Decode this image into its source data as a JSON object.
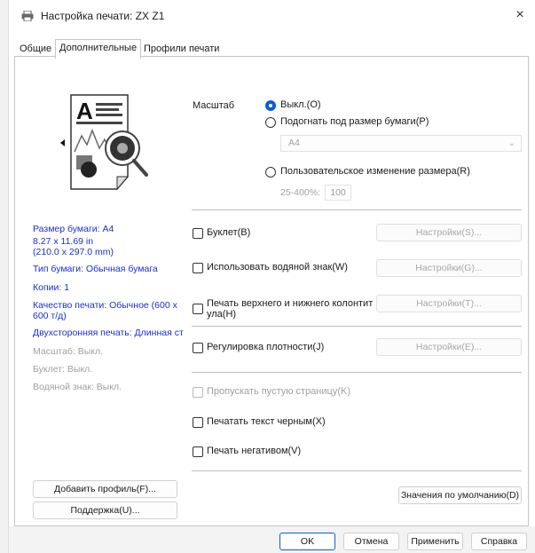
{
  "window": {
    "title": "Настройка печати: ZX Z1",
    "close_symbol": "×"
  },
  "tabs": [
    "Общие",
    "Дополнительные",
    "Профили печати"
  ],
  "summary": {
    "paper_size": "Размер бумаги: A4",
    "paper_dims_1": "8.27 x 11.69 in",
    "paper_dims_2": "(210.0 x 297.0 mm)",
    "paper_type": "Тип бумаги: Обычная бумага",
    "copies": "Копии: 1",
    "quality_1": "Качество печати: Обычное (600 x",
    "quality_2": "600 т/д)",
    "duplex": "Двухсторонняя печать: Длинная ст",
    "scale": "Масштаб: Выкл.",
    "booklet": "Буклет: Выкл.",
    "watermark": "Водяной знак: Выкл."
  },
  "scaling": {
    "label": "Масштаб",
    "off": "Выкл.(O)",
    "fit": "Подогнать под размер бумаги(P)",
    "paper_value": "A4",
    "custom": "Пользовательское изменение размера(R)",
    "range": "25-400%:",
    "percent": "100"
  },
  "options": {
    "booklet": "Буклет(B)",
    "watermark": "Использовать водяной знак(W)",
    "header_footer_1": "Печать верхнего и нижнего колонтит",
    "header_footer_2": "ула(H)",
    "density": "Регулировка плотности(J)",
    "skip_blank": "Пропускать пустую страницу(K)",
    "black_text": "Печатать текст черным(X)",
    "negative": "Печать негативом(V)"
  },
  "settings_buttons": {
    "booklet": "Настройки(S)...",
    "watermark": "Настройки(G)...",
    "header_footer": "Настройки(T)...",
    "density": "Настройки(E)..."
  },
  "buttons": {
    "add_profile": "Добавить профиль(F)...",
    "support": "Поддержка(U)...",
    "defaults": "Значения по умолчанию(D)",
    "ok": "OK",
    "cancel": "Отмена",
    "apply": "Применить",
    "help": "Справка"
  },
  "colors": {
    "accent": "#0b5cd7",
    "summary_text": "#1a2fd0",
    "disabled_text": "#a0a0a0"
  },
  "icons": {
    "title": "printer-icon",
    "preview": "page-preview-icon",
    "zoom": "magnifier-icon",
    "dropdown": "chevron-down-icon"
  }
}
